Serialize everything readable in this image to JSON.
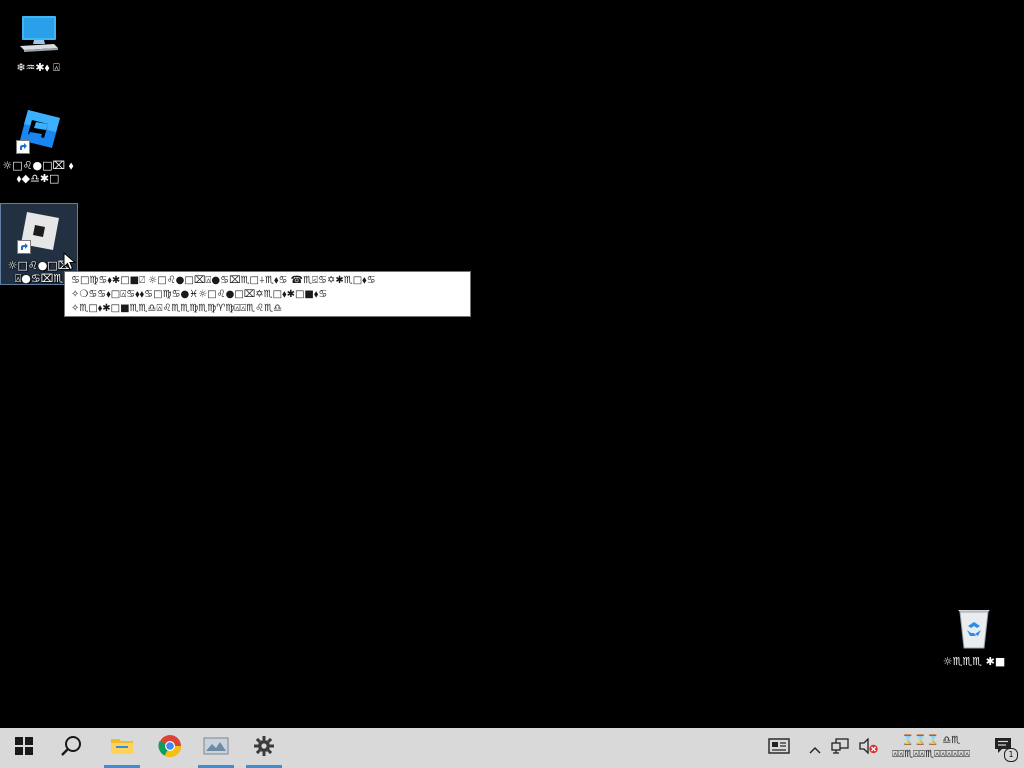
{
  "desktop": {
    "icons": [
      {
        "name": "this-pc",
        "label": "❄♒✱⬧ ⍓"
      },
      {
        "name": "roblox-studio",
        "label": "☼□♌●□⌧ ⬧⬧◆♎✱□"
      },
      {
        "name": "roblox-player",
        "label": "☼□♌●□⌧ ⍓●♋⌧♏"
      }
    ],
    "recycle_bin": {
      "label": "☼♏♏♏ ✱■"
    }
  },
  "tooltip": {
    "lines": [
      "♋□♍♋⬧✱□■⍁ ☼□♌●□⌧⍓●♋⌧♏□⍭♏⬧♋ ☎♏⍃♋✡✱♏□⬧♋",
      "✧❍♋♋⬧□⍓♋⬧⬧♋□♍♋●♓☼□♌●□⌧✡♏□⬧✱□■⬧♋",
      "✧♏□⬧✱□■♏♏♎⍓♌♏♏♍♏♍♈♍⍓⍓♏♌♏♎"
    ]
  },
  "taskbar": {
    "buttons": [
      {
        "name": "start-button",
        "icon": "windows-icon",
        "running": false
      },
      {
        "name": "search-button",
        "icon": "search-icon",
        "running": false
      },
      {
        "name": "file-explorer-button",
        "icon": "folder-icon",
        "running": true
      },
      {
        "name": "chrome-button",
        "icon": "chrome-icon",
        "running": false
      },
      {
        "name": "app-button",
        "icon": "image-viewer-icon",
        "running": true
      },
      {
        "name": "settings-button",
        "icon": "gear-icon",
        "running": true
      }
    ],
    "tray": {
      "time": "⌛⌛⌛ ♎♏",
      "date": "⍓⍓♏⍓⍓♏⍓⍓⍓⍓⍓⍓",
      "notification_count": "1"
    }
  },
  "colors": {
    "desktop_bg": "#000000",
    "taskbar_bg": "#d9d9d9",
    "accent": "#3a8fd9",
    "selection": "#3f6f9f"
  }
}
